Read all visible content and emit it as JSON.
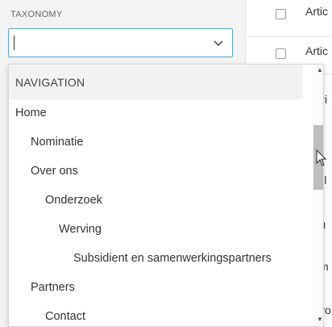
{
  "filter": {
    "taxonomy_label": "TAXONOMY",
    "select_value": ""
  },
  "table": {
    "rows": [
      {
        "text": "Artic"
      },
      {
        "text": "Artic"
      }
    ],
    "fragments": [
      "vi",
      "i",
      "ill",
      "rı",
      "m",
      "vo"
    ]
  },
  "dropdown": {
    "header": "NAVIGATION",
    "options": [
      {
        "label": "Home",
        "level": 0
      },
      {
        "label": "Nominatie",
        "level": 1
      },
      {
        "label": "Over ons",
        "level": 1
      },
      {
        "label": "Onderzoek",
        "level": 2
      },
      {
        "label": "Werving",
        "level": 3
      },
      {
        "label": "Subsidient en samenwerkingspartners",
        "level": 4
      },
      {
        "label": "Partners",
        "level": 1
      },
      {
        "label": "Contact",
        "level": 2
      }
    ]
  },
  "colors": {
    "focus_border": "#5aa3d6",
    "header_bg": "#f2f2f2",
    "panel_bg": "#f3f3f3"
  }
}
